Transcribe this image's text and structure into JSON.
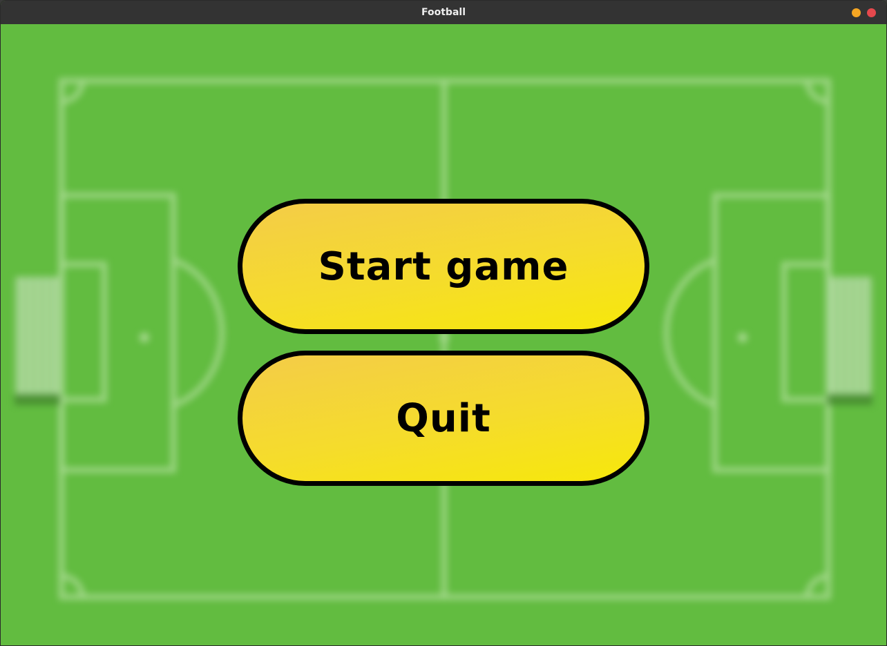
{
  "window": {
    "title": "Football",
    "minimize_color": "#f5a623",
    "close_color": "#e5484d"
  },
  "background": {
    "grass_color": "#62bc40",
    "line_color": "#a7d98f"
  },
  "menu": {
    "start_label": "Start game",
    "quit_label": "Quit",
    "button_gradient_top": "#f4cc48",
    "button_gradient_bottom": "#f7e80a",
    "button_border_color": "#000000"
  }
}
